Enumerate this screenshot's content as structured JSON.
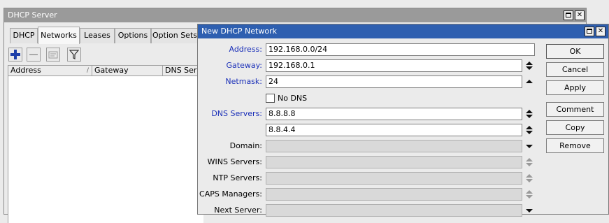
{
  "main_window": {
    "title": "DHCP Server",
    "tabs": [
      {
        "label": "DHCP"
      },
      {
        "label": "Networks"
      },
      {
        "label": "Leases"
      },
      {
        "label": "Options"
      },
      {
        "label": "Option Sets"
      }
    ],
    "toolbar": {
      "add_icon": "plus-icon",
      "remove_icon": "minus-icon",
      "comment_icon": "note-icon",
      "filter_icon": "filter-icon"
    },
    "columns": [
      "Address",
      "Gateway",
      "DNS Serve"
    ],
    "sort_indicator": "/"
  },
  "dialog": {
    "title": "New DHCP Network",
    "fields": {
      "address": {
        "label": "Address:",
        "value": "192.168.0.0/24"
      },
      "gateway": {
        "label": "Gateway:",
        "value": "192.168.0.1"
      },
      "netmask": {
        "label": "Netmask:",
        "value": "24"
      },
      "no_dns": {
        "label": "No DNS",
        "checked": false
      },
      "dns1": {
        "label": "DNS Servers:",
        "value": "8.8.8.8"
      },
      "dns2": {
        "value": "8.8.4.4"
      },
      "domain": {
        "label": "Domain:",
        "value": ""
      },
      "wins": {
        "label": "WINS Servers:",
        "value": ""
      },
      "ntp": {
        "label": "NTP Servers:",
        "value": ""
      },
      "caps": {
        "label": "CAPS Managers:",
        "value": ""
      },
      "next_server": {
        "label": "Next Server:",
        "value": ""
      }
    },
    "buttons": {
      "ok": "OK",
      "cancel": "Cancel",
      "apply": "Apply",
      "comment": "Comment",
      "copy": "Copy",
      "remove": "Remove"
    }
  },
  "colors": {
    "dialog_title_bg": "#2e5fb0",
    "main_title_bg": "#9a9a9a",
    "label_blue": "#1a2fb8",
    "add_icon": "#1d3fa8"
  }
}
